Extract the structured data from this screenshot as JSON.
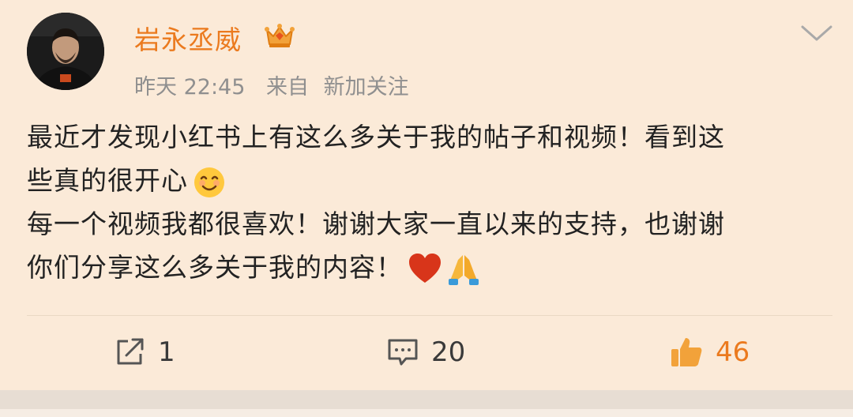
{
  "post": {
    "username": "岩永丞威",
    "time": "昨天 22:45",
    "source_label": "来自",
    "source": "新加关注",
    "lines": [
      "最近才发现小红书上有这么多关于我的帖子和视频！看到这",
      "些真的很开心",
      "每一个视频我都很喜欢！谢谢大家一直以来的支持，也谢谢",
      "你们分享这么多关于我的内容！"
    ]
  },
  "actions": {
    "repost_count": "1",
    "comment_count": "20",
    "like_count": "46"
  },
  "icons": {
    "badge": "crown-icon",
    "menu": "chevron-down-icon",
    "repost": "share-icon",
    "comment": "comment-icon",
    "like": "thumbs-up-icon",
    "emoji_smile": "smiling-face-icon",
    "emoji_heart": "red-heart-icon",
    "emoji_pray": "folded-hands-icon"
  },
  "colors": {
    "background": "#fbead8",
    "username": "#eb7a1e",
    "meta": "#8f8f8f",
    "text": "#222222",
    "like": "#eb7a1e"
  }
}
